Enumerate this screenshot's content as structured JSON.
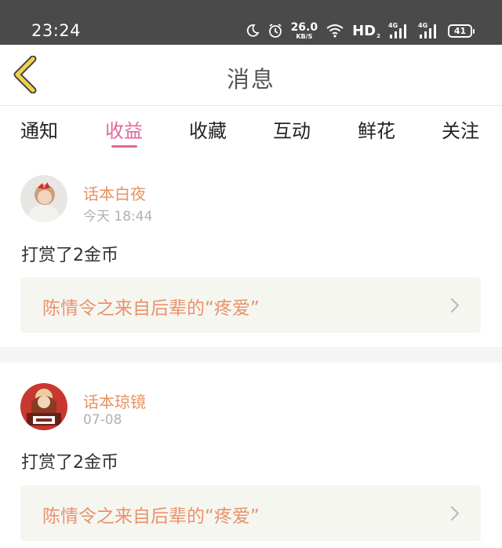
{
  "status_bar": {
    "time": "23:24",
    "net_speed": "26.0",
    "net_speed_unit": "KB/S",
    "hd_label": "HD",
    "hd_sub": "2",
    "signal1_label": "4G",
    "signal2_label": "4G",
    "battery": "41"
  },
  "header": {
    "title": "消息",
    "back_icon": "chevron-left-icon",
    "back_color": "#f2d24a"
  },
  "tabs": [
    {
      "label": "通知",
      "active": false
    },
    {
      "label": "收益",
      "active": true
    },
    {
      "label": "收藏",
      "active": false
    },
    {
      "label": "互动",
      "active": false
    },
    {
      "label": "鲜花",
      "active": false
    },
    {
      "label": "关注",
      "active": false
    }
  ],
  "colors": {
    "accent": "#e0689a",
    "username": "#e6935e",
    "link_text": "#e8936b",
    "link_bg": "#f6f6f1"
  },
  "notifications": [
    {
      "username": "话本白夜",
      "time": "今天 18:44",
      "message": "打赏了2金币",
      "link": "陈情令之来自后辈的“疼爱”"
    },
    {
      "username": "话本琼镜",
      "time": "07-08",
      "message": "打赏了2金币",
      "link": "陈情令之来自后辈的“疼爱”"
    }
  ]
}
